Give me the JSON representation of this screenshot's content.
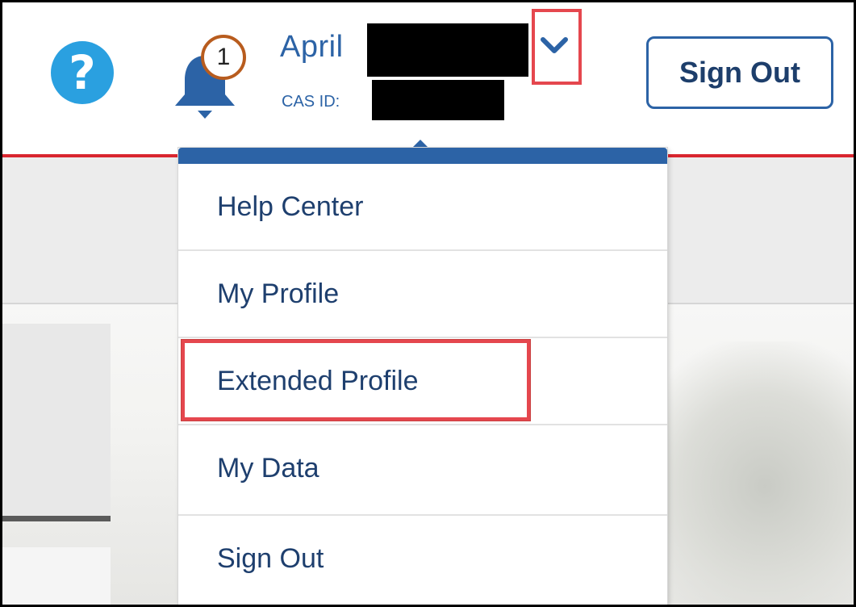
{
  "header": {
    "help_icon_glyph": "?",
    "notification_count": "1",
    "user_name": "April",
    "cas_id_label": "CAS ID:",
    "sign_out_label": "Sign Out"
  },
  "menu": {
    "items": [
      {
        "label": "Help Center"
      },
      {
        "label": "My Profile"
      },
      {
        "label": "Extended Profile"
      },
      {
        "label": "My Data"
      },
      {
        "label": "Sign Out"
      }
    ]
  },
  "colors": {
    "accent_blue": "#2c63a6",
    "help_blue": "#2aa0e0",
    "brand_red": "#d9262f",
    "annotation_red": "#e5474e",
    "badge_orange": "#b85c1e"
  }
}
